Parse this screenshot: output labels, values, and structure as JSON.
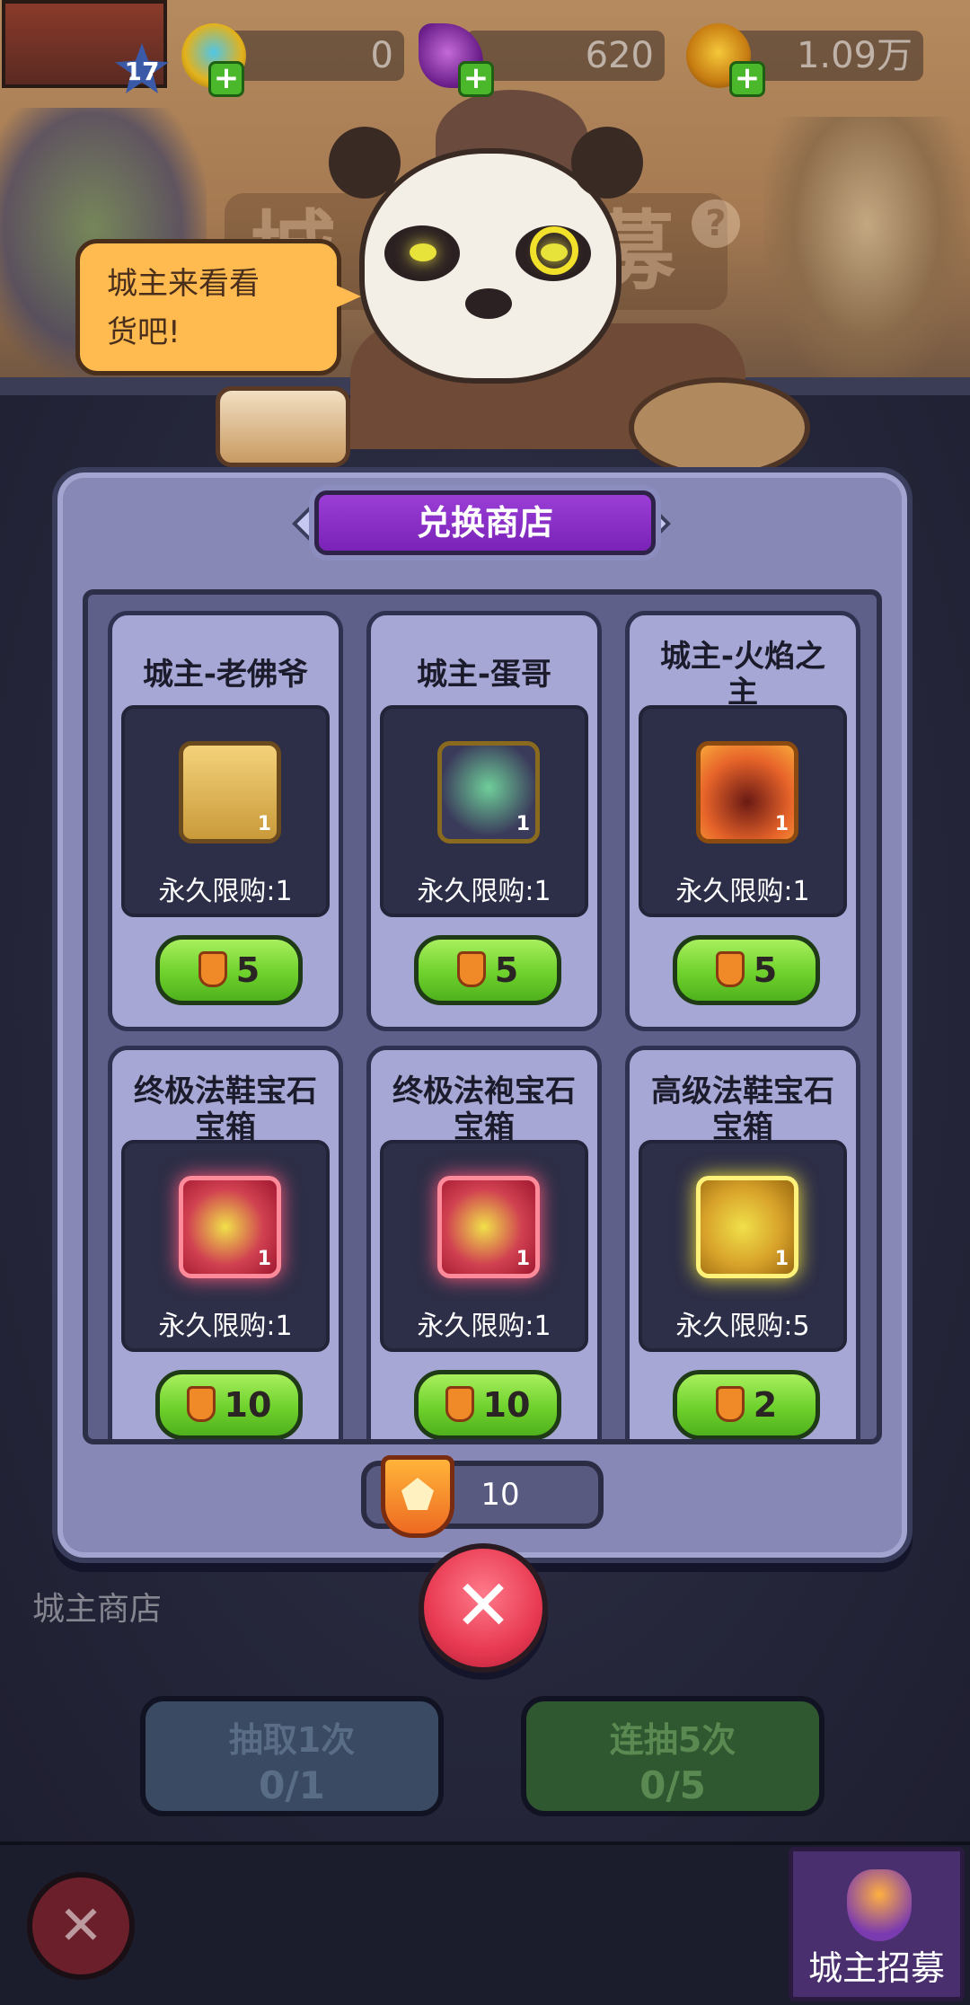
{
  "hud": {
    "level": "17",
    "diamonds": "0",
    "crystals": "620",
    "gold": "1.09万"
  },
  "background": {
    "title_ghost": "城主招募",
    "help_glyph": "?",
    "shop_label": "城主商店",
    "draw_one": {
      "label": "抽取1次",
      "count": "0/1"
    },
    "draw_five": {
      "label": "连抽5次",
      "count": "0/5"
    },
    "recruit_tab": "城主招募"
  },
  "speech_bubble": {
    "line1": "城主来看看",
    "line2": "货吧!"
  },
  "shop": {
    "title": "兑换商店",
    "currency_amount": "10",
    "items": [
      {
        "name_line1": "城主-老佛爷",
        "name_line2": "",
        "limit": "永久限购:1",
        "qty": "1",
        "price": "5",
        "icon": "lord-old-man-portrait"
      },
      {
        "name_line1": "城主-蛋哥",
        "name_line2": "",
        "limit": "永久限购:1",
        "qty": "1",
        "price": "5",
        "icon": "lord-demon-hunter-portrait"
      },
      {
        "name_line1": "城主-火焰之",
        "name_line2": "主",
        "limit": "永久限购:1",
        "qty": "1",
        "price": "5",
        "icon": "lord-fire-lord-portrait"
      },
      {
        "name_line1": "终极法鞋宝石",
        "name_line2": "宝箱",
        "limit": "永久限购:1",
        "qty": "1",
        "price": "10",
        "icon": "gem-chest-red-icon"
      },
      {
        "name_line1": "终极法袍宝石",
        "name_line2": "宝箱",
        "limit": "永久限购:1",
        "qty": "1",
        "price": "10",
        "icon": "gem-chest-red-icon"
      },
      {
        "name_line1": "高级法鞋宝石",
        "name_line2": "宝箱",
        "limit": "永久限购:5",
        "qty": "1",
        "price": "2",
        "icon": "gem-chest-gold-icon"
      }
    ]
  },
  "colors": {
    "panel": "#8788b6",
    "title_purple": "#8a2fc8",
    "buy_green": "#6ed12c",
    "close_red": "#e83a52"
  }
}
